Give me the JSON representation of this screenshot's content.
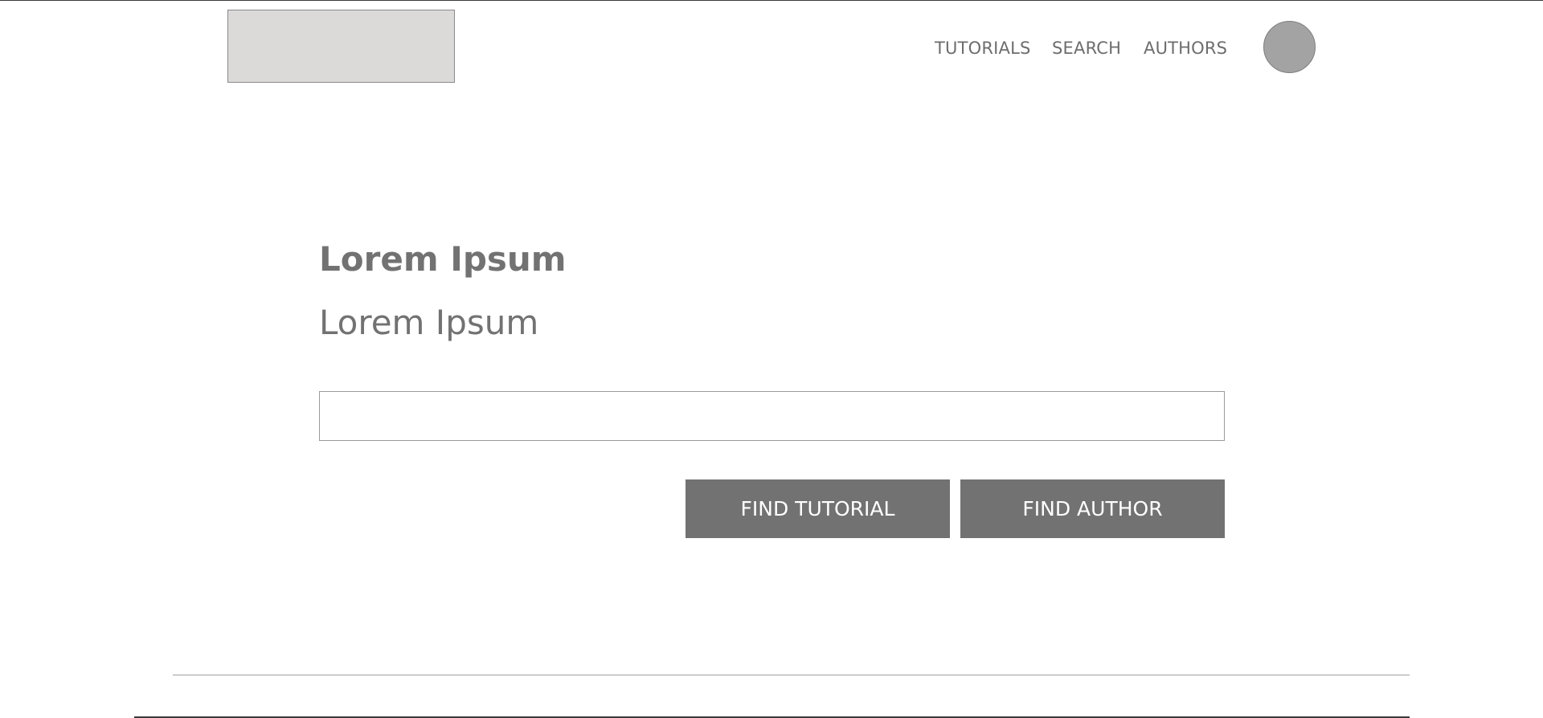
{
  "header": {
    "nav": [
      {
        "label": "TUTORIALS"
      },
      {
        "label": "SEARCH"
      },
      {
        "label": "AUTHORS"
      }
    ]
  },
  "hero": {
    "title": "Lorem Ipsum",
    "subtitle": "Lorem Ipsum"
  },
  "search": {
    "value": "",
    "placeholder": ""
  },
  "actions": {
    "find_tutorial_label": "FIND TUTORIAL",
    "find_author_label": "FIND AUTHOR"
  },
  "colors": {
    "button_bg": "#727272",
    "text_gray": "#6d6d6d",
    "logo_placeholder": "#dcd9d9",
    "avatar_fill": "#a3a3a3"
  },
  "icons": {
    "logo": "logo-placeholder",
    "avatar": "user-avatar-placeholder"
  }
}
